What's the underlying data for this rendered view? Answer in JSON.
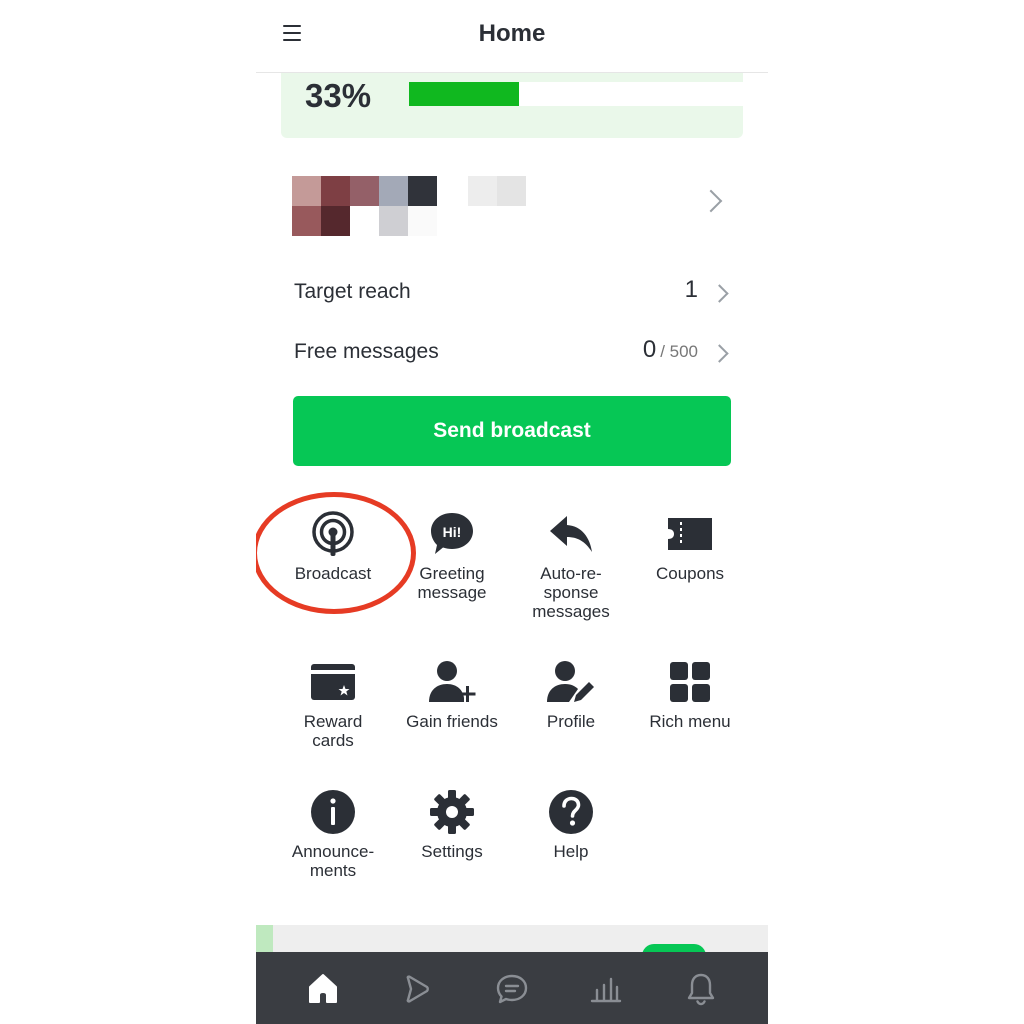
{
  "header": {
    "title": "Home",
    "menu_icon": "hamburger-menu-icon"
  },
  "progress": {
    "percent_label": "33%",
    "value": 0.33,
    "color": "#10b81f"
  },
  "account": {
    "avatar": "pixelated-account-avatar",
    "name": ""
  },
  "stats": {
    "target_reach": {
      "label": "Target reach",
      "value": "1"
    },
    "free_messages": {
      "label": "Free messages",
      "value": "0",
      "total": "/ 500"
    }
  },
  "send_button": {
    "label": "Send broadcast",
    "color": "#06c755"
  },
  "features": [
    {
      "label": "Broadcast",
      "icon": "broadcast-icon",
      "highlighted": true
    },
    {
      "label": "Greeting\nmessage",
      "icon": "greeting-message-icon",
      "icon_text": "Hi!"
    },
    {
      "label": "Auto-re-\nsponse\nmessages",
      "icon": "reply-arrow-icon"
    },
    {
      "label": "Coupons",
      "icon": "coupon-icon"
    },
    {
      "label": "Reward\ncards",
      "icon": "reward-card-icon"
    },
    {
      "label": "Gain friends",
      "icon": "add-friend-icon"
    },
    {
      "label": "Profile",
      "icon": "profile-edit-icon"
    },
    {
      "label": "Rich menu",
      "icon": "rich-menu-icon"
    },
    {
      "label": "Announce-\nments",
      "icon": "info-icon"
    },
    {
      "label": "Settings",
      "icon": "gear-icon"
    },
    {
      "label": "Help",
      "icon": "help-icon"
    }
  ],
  "bottom_nav": [
    {
      "icon": "home-icon",
      "active": true
    },
    {
      "icon": "play-icon",
      "active": false
    },
    {
      "icon": "chat-icon",
      "active": false
    },
    {
      "icon": "stats-icon",
      "active": false
    },
    {
      "icon": "bell-icon",
      "active": false
    }
  ],
  "colors": {
    "accent": "#06c755",
    "highlight": "#e63b24",
    "nav_bg": "#3a3d42",
    "text": "#2b2f36"
  }
}
